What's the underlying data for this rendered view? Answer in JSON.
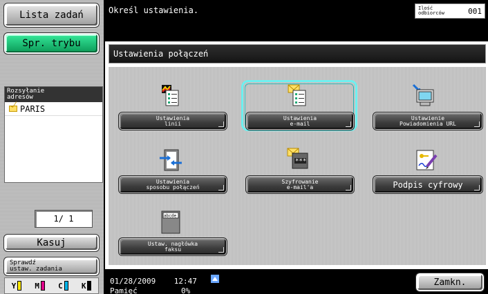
{
  "sidebar": {
    "job_list": "Lista zadań",
    "mode_check": "Spr. trybu",
    "addr_header": "Rozsyłanie\nadresów",
    "addresses": [
      "PARIS"
    ],
    "page": "1/ 1",
    "clear": "Kasuj",
    "check_settings": "Sprawdź\nustaw. zadania",
    "toner": [
      "Y",
      "M",
      "C",
      "K"
    ]
  },
  "top": {
    "message": "Określ ustawienia.",
    "counter_label": "Ilość\nodbiorców",
    "counter_value": "001"
  },
  "panel": {
    "title": "Ustawienia połączeń",
    "buttons": [
      {
        "label": "Ustawienia\nlinii",
        "icon": "line-settings-icon"
      },
      {
        "label": "Ustawienia\ne-mail",
        "icon": "email-settings-icon",
        "selected": true
      },
      {
        "label": "Ustawienie\nPowiadomienia URL",
        "icon": "url-notification-icon"
      },
      {
        "label": "Ustawienia\nsposobu połączeń",
        "icon": "connection-method-icon"
      },
      {
        "label": "Szyfrowanie\ne-mail'a",
        "icon": "email-encryption-icon"
      },
      {
        "label": "Podpis cyfrowy",
        "icon": "digital-signature-icon"
      },
      {
        "label": "Ustaw. nagłówka\nfaksu",
        "icon": "fax-header-icon"
      }
    ]
  },
  "status": {
    "datetime": "01/28/2009    12:47",
    "memory_label": "Pamięć",
    "memory_value": "0%"
  },
  "close": "Zamkn.",
  "colors": {
    "accent_green": "#1ec47a",
    "selection": "#6ef0f0"
  }
}
